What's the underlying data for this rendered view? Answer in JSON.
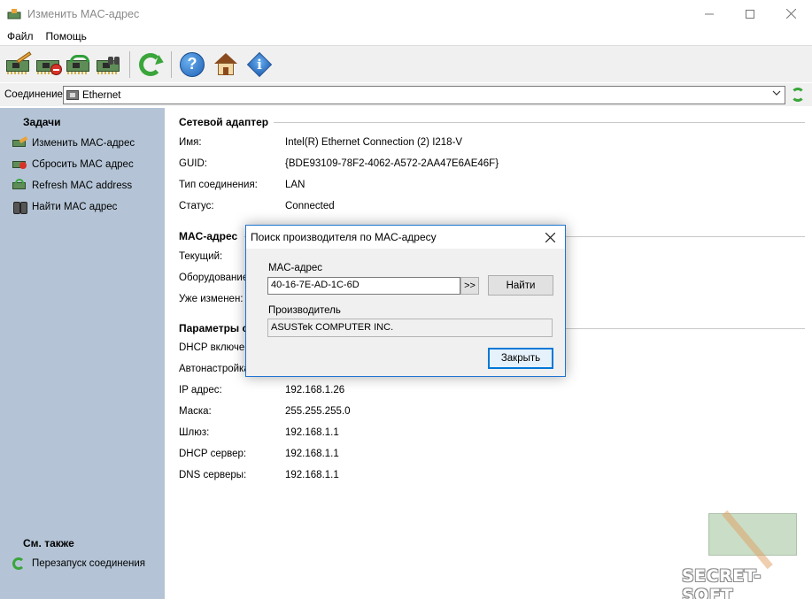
{
  "window": {
    "title": "Изменить MAC-адрес"
  },
  "menu": {
    "items": [
      "Файл",
      "Помощь"
    ]
  },
  "connection": {
    "label": "Соединение:",
    "value": "Ethernet"
  },
  "sidebar": {
    "tasks_heading": "Задачи",
    "tasks": [
      {
        "label": "Изменить MAC-адрес",
        "icon": "nic-edit-icon"
      },
      {
        "label": "Сбросить MAC адрес",
        "icon": "nic-reset-icon"
      },
      {
        "label": "Refresh MAC address",
        "icon": "nic-refresh-icon"
      },
      {
        "label": "Найти MAC адрес",
        "icon": "binoculars-icon"
      }
    ],
    "see_also_heading": "См. также",
    "see_also": [
      {
        "label": "Перезапуск соединения",
        "icon": "refresh-icon"
      }
    ]
  },
  "adapter": {
    "heading": "Сетевой адаптер",
    "rows": [
      {
        "label": "Имя:",
        "value": "Intel(R) Ethernet Connection (2) I218-V"
      },
      {
        "label": "GUID:",
        "value": "{BDE93109-78F2-4062-A572-2AA47E6AE46F}"
      },
      {
        "label": "Тип соединения:",
        "value": "LAN"
      },
      {
        "label": "Статус:",
        "value": "Connected"
      }
    ]
  },
  "mac": {
    "heading": "MAC-адрес",
    "rows": [
      {
        "label": "Текущий:"
      },
      {
        "label": "Оборудование:"
      },
      {
        "label": "Уже изменен:"
      }
    ]
  },
  "params": {
    "heading": "Параметры с",
    "rows": [
      {
        "label": "DHCP включен",
        "value": ""
      },
      {
        "label": "Автонастройка",
        "value": ""
      },
      {
        "label": "IP адрес:",
        "value": "192.168.1.26"
      },
      {
        "label": "Маска:",
        "value": "255.255.255.0"
      },
      {
        "label": "Шлюз:",
        "value": "192.168.1.1"
      },
      {
        "label": "DHCP сервер:",
        "value": "192.168.1.1"
      },
      {
        "label": "DNS серверы:",
        "value": "192.168.1.1"
      }
    ]
  },
  "dialog": {
    "title": "Поиск производителя по MAC-адресу",
    "mac_label": "MAC-адрес",
    "mac_value": "40-16-7E-AD-1C-6D",
    "arrow_label": ">>",
    "find_label": "Найти",
    "vendor_label": "Производитель",
    "vendor_value": "ASUSTek COMPUTER INC.",
    "close_label": "Закрыть"
  },
  "watermark": "SECRET-SOFT",
  "colors": {
    "sidebar_bg": "#b4c4d6",
    "accent": "#0078d7",
    "icon_green": "#3aa53a"
  }
}
